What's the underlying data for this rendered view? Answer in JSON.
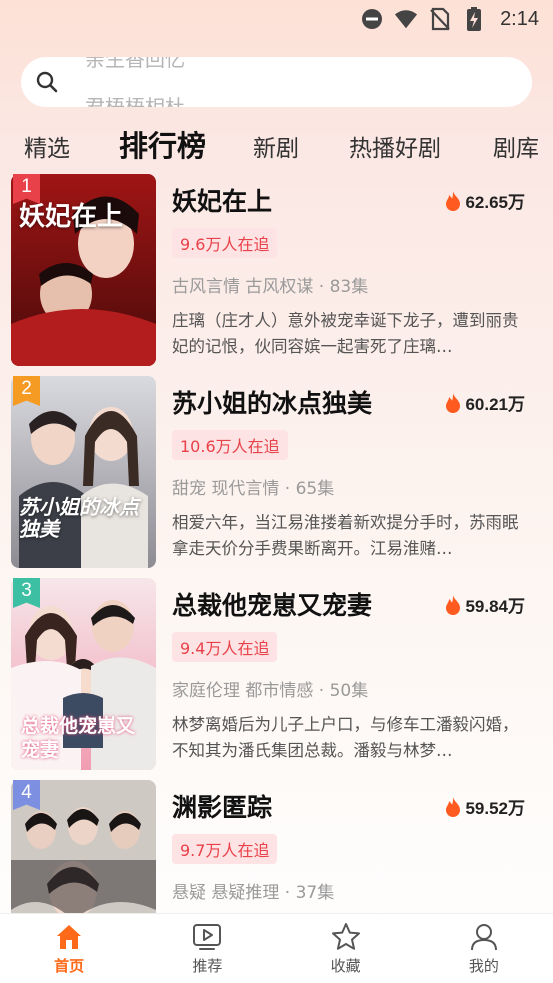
{
  "status_bar": {
    "time": "2:14"
  },
  "search": {
    "placeholder_top": "亲生香回忆",
    "placeholder_bottom": "君梧梧相杜"
  },
  "tabs": [
    {
      "label": "精选",
      "active": false
    },
    {
      "label": "排行榜",
      "active": true
    },
    {
      "label": "新剧",
      "active": false
    },
    {
      "label": "热播好剧",
      "active": false
    },
    {
      "label": "剧库",
      "active": false
    }
  ],
  "ranking": [
    {
      "rank": "1",
      "title": "妖妃在上",
      "heat": "62.65万",
      "followers": "9.6万人在追",
      "meta": "古风言情 古风权谋 · 83集",
      "description": "庄璃（庄才人）意外被宠幸诞下龙子，遭到丽贵妃的记恨，伙同容嫔一起害死了庄璃…",
      "cover_text": "妖妃在上",
      "rank_color": "#e9414a"
    },
    {
      "rank": "2",
      "title": "苏小姐的冰点独美",
      "heat": "60.21万",
      "followers": "10.6万人在追",
      "meta": "甜宠 现代言情 · 65集",
      "description": "相爱六年，当江易淮搂着新欢提分手时，苏雨眠拿走天价分手费果断离开。江易淮赌…",
      "cover_text": "苏小姐的冰点独美",
      "rank_color": "#f59a23"
    },
    {
      "rank": "3",
      "title": "总裁他宠崽又宠妻",
      "heat": "59.84万",
      "followers": "9.4万人在追",
      "meta": "家庭伦理 都市情感 · 50集",
      "description": "林梦离婚后为儿子上户口，与修车工潘毅闪婚，不知其为潘氏集团总裁。潘毅与林梦…",
      "cover_text": "总裁他宠崽又宠妻",
      "rank_color": "#3cbfa3"
    },
    {
      "rank": "4",
      "title": "渊影匿踪",
      "heat": "59.52万",
      "followers": "9.7万人在追",
      "meta": "悬疑 悬疑推理 · 37集",
      "description": "",
      "cover_text": "",
      "rank_color": "#7d8fe0"
    }
  ],
  "bottom_nav": [
    {
      "label": "首页",
      "icon": "home-icon",
      "active": true
    },
    {
      "label": "推荐",
      "icon": "play-screen-icon",
      "active": false
    },
    {
      "label": "收藏",
      "icon": "star-icon",
      "active": false
    },
    {
      "label": "我的",
      "icon": "user-icon",
      "active": false
    }
  ],
  "colors": {
    "accent": "#ff6a1a",
    "follow_text": "#e9414a",
    "follow_bg": "#fde3e3",
    "flame": "#ff5a1f"
  }
}
